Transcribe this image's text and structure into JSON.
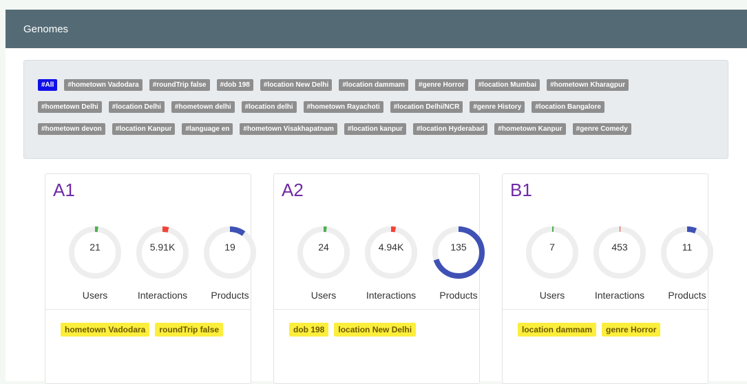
{
  "panel": {
    "title": "Genomes"
  },
  "tags": {
    "row1": [
      "#All",
      "#hometown Vadodara",
      "#roundTrip false",
      "#dob 198",
      "#location New Delhi",
      "#location dammam",
      "#genre Horror",
      "#location Mumbai",
      "#hometown Kharagpur"
    ],
    "row2": [
      "#hometown Delhi",
      "#location Delhi",
      "#hometown delhi",
      "#location delhi",
      "#hometown Rayachoti",
      "#location Delhi/NCR",
      "#genre History",
      "#location Bangalore"
    ],
    "row3": [
      "#hometown devon",
      "#location Kanpur",
      "#language en",
      "#hometown Visakhapatnam",
      "#location kanpur",
      "#location Hyderabad",
      "#hometown Kanpur",
      "#genre Comedy"
    ],
    "active": "#All"
  },
  "cards": [
    {
      "title": "A1",
      "metrics": [
        {
          "label": "Users",
          "value": "21",
          "fraction": 0.02,
          "color": "#4caf50"
        },
        {
          "label": "Interactions",
          "value": "5.91K",
          "fraction": 0.04,
          "color": "#f44336"
        },
        {
          "label": "Products",
          "value": "19",
          "fraction": 0.1,
          "color": "#3f51b5"
        }
      ],
      "tags": [
        "hometown Vadodara",
        "roundTrip false"
      ]
    },
    {
      "title": "A2",
      "metrics": [
        {
          "label": "Users",
          "value": "24",
          "fraction": 0.02,
          "color": "#4caf50"
        },
        {
          "label": "Interactions",
          "value": "4.94K",
          "fraction": 0.03,
          "color": "#f44336"
        },
        {
          "label": "Products",
          "value": "135",
          "fraction": 0.7,
          "color": "#3f51b5"
        }
      ],
      "tags": [
        "dob 198",
        "location New Delhi"
      ]
    },
    {
      "title": "B1",
      "metrics": [
        {
          "label": "Users",
          "value": "7",
          "fraction": 0.01,
          "color": "#4caf50"
        },
        {
          "label": "Interactions",
          "value": "453",
          "fraction": 0.005,
          "color": "#f44336"
        },
        {
          "label": "Products",
          "value": "11",
          "fraction": 0.06,
          "color": "#3f51b5"
        }
      ],
      "tags": [
        "location dammam",
        "genre Horror"
      ]
    }
  ]
}
